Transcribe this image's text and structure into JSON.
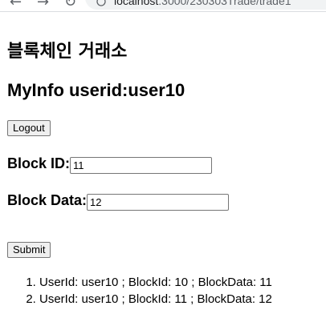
{
  "browser": {
    "back_icon": "arrow-left-icon",
    "forward_icon": "arrow-right-icon",
    "reload_icon": "reload-icon",
    "url_host": "localhost",
    "url_path": ":3000/230303Trade/trade1"
  },
  "page": {
    "title": "블록체인 거래소",
    "myinfo": "MyInfo userid:user10",
    "logout_label": "Logout",
    "block_id_label": "Block ID:",
    "block_id_value": "11",
    "block_data_label": "Block Data:",
    "block_data_value": "12",
    "submit_label": "Submit"
  },
  "results": [
    "UserId: user10 ; BlockId: 10 ; BlockData: 11",
    "UserId: user10 ; BlockId: 11 ; BlockData: 12"
  ]
}
